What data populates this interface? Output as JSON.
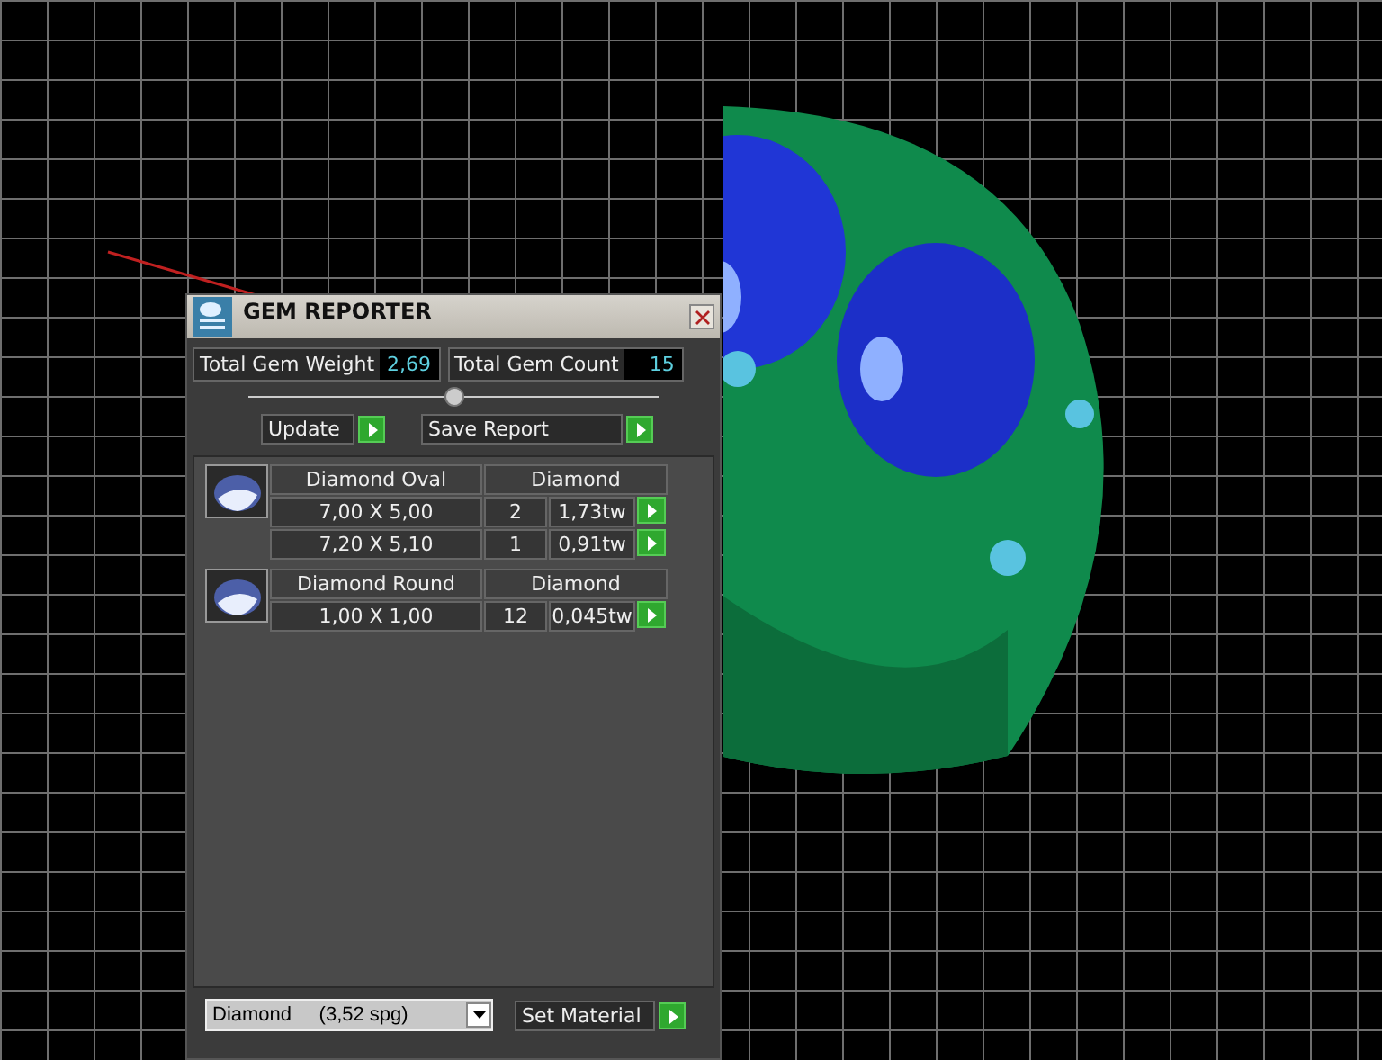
{
  "window": {
    "title": "GEM REPORTER"
  },
  "stats": [
    {
      "label": "Total Gem Weight",
      "value": "2,69"
    },
    {
      "label": "Total Gem Count",
      "value": "15"
    }
  ],
  "actions": [
    "Update",
    "Save Report"
  ],
  "gem_groups": [
    {
      "shape": "Diamond Oval",
      "material": "Diamond",
      "rows": [
        {
          "size": "7,00 X 5,00",
          "count": "2",
          "weight": "1,73tw"
        },
        {
          "size": "7,20 X 5,10",
          "count": "1",
          "weight": "0,91tw"
        }
      ]
    },
    {
      "shape": "Diamond Round",
      "material": "Diamond",
      "rows": [
        {
          "size": "1,00 X 1,00",
          "count": "12",
          "weight": "0,045tw"
        }
      ]
    }
  ],
  "material_select": {
    "value": "Diamond     (3,52 spg)"
  },
  "set_material_button": "Set Material"
}
